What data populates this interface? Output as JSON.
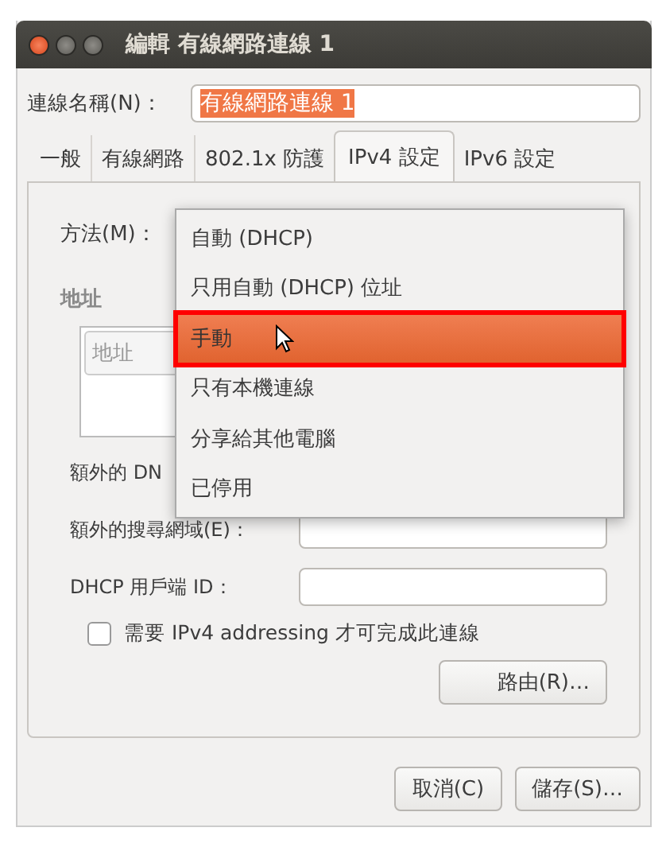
{
  "window": {
    "title": "編輯 有線網路連線 1"
  },
  "connection_name": {
    "label": "連線名稱(N)：",
    "value": "有線網路連線 1",
    "text_selected": true
  },
  "tabs": [
    {
      "label": "一般",
      "selected": false
    },
    {
      "label": "有線網路",
      "selected": false
    },
    {
      "label": "802.1x 防護",
      "selected": false
    },
    {
      "label": "IPv4 設定",
      "selected": true
    },
    {
      "label": "IPv6 設定",
      "selected": false
    }
  ],
  "method": {
    "label": "方法(M)：",
    "menu": [
      {
        "label": "自動 (DHCP)",
        "selected": false,
        "outlined": false
      },
      {
        "label": "只用自動 (DHCP) 位址",
        "selected": false,
        "outlined": false
      },
      {
        "label": "手動",
        "selected": true,
        "outlined": true
      },
      {
        "label": "只有本機連線",
        "selected": false,
        "outlined": false
      },
      {
        "label": "分享給其他電腦",
        "selected": false,
        "outlined": false
      },
      {
        "label": "已停用",
        "selected": false,
        "outlined": false
      }
    ]
  },
  "addresses": {
    "heading": "地址",
    "column_1": "地址"
  },
  "fields": [
    {
      "label": "額外的 DN"
    },
    {
      "label": "額外的搜尋網域(E)："
    },
    {
      "label": "DHCP 用戶端 ID："
    }
  ],
  "require_ipv4": {
    "label": "需要 IPv4 addressing 才可完成此連線",
    "checked": false
  },
  "routes_button": "路由(R)…",
  "buttons": [
    "取消(C)",
    "儲存(S)…"
  ]
}
